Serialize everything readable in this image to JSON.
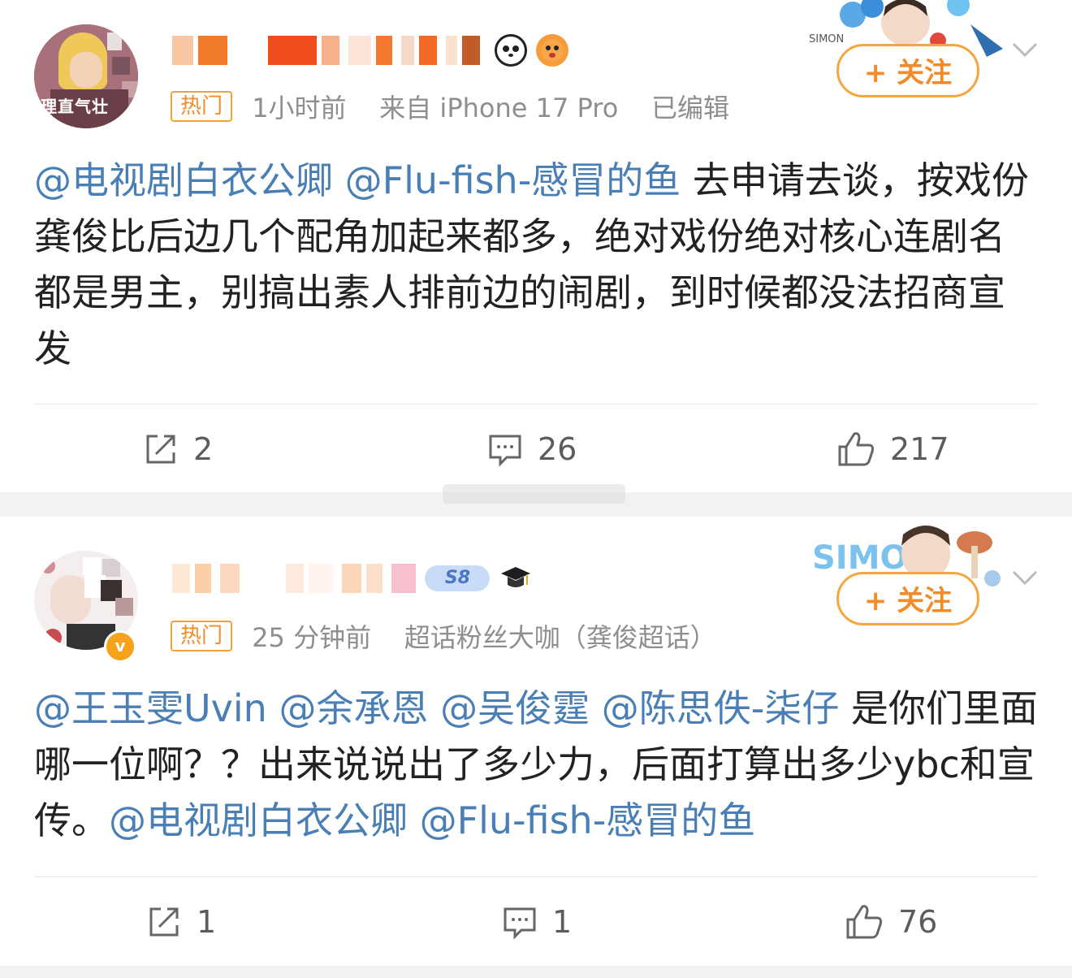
{
  "posts": [
    {
      "avatar_caption": "理直气壮",
      "hot_label": "热门",
      "time": "1小时前",
      "source": "来自 iPhone 17 Pro",
      "edited": "已编辑",
      "follow_label": "+ 关注",
      "deco_text": "SIMON",
      "content": [
        {
          "text": "@电视剧白衣公卿",
          "mention": true
        },
        {
          "text": " ",
          "mention": false
        },
        {
          "text": "@Flu-fish-感冒的鱼",
          "mention": true
        },
        {
          "text": " 去申请去谈，按戏份龚俊比后边几个配角加起来都多，绝对戏份绝对核心连剧名都是男主，别搞出素人排前边的闹剧，到时候都没法招商宣发",
          "mention": false
        }
      ],
      "repost_count": "2",
      "comment_count": "26",
      "like_count": "217"
    },
    {
      "hot_label": "热门",
      "time": "25 分钟前",
      "source": "超话粉丝大咖（龚俊超话）",
      "level_badge": "S8",
      "follow_label": "+ 关注",
      "deco_text": "SIMON",
      "verified_label": "v",
      "content": [
        {
          "text": "@王玉雯Uvin",
          "mention": true
        },
        {
          "text": " ",
          "mention": false
        },
        {
          "text": "@余承恩",
          "mention": true
        },
        {
          "text": " ",
          "mention": false
        },
        {
          "text": "@吴俊霆",
          "mention": true
        },
        {
          "text": " ",
          "mention": false
        },
        {
          "text": "@陈思佚-柒仔",
          "mention": true
        },
        {
          "text": " 是你们里面哪一位啊？？出来说说出了多少力，后面打算出多少ybc和宣传。",
          "mention": false
        },
        {
          "text": "@电视剧白衣公卿",
          "mention": true
        },
        {
          "text": " ",
          "mention": false
        },
        {
          "text": "@Flu-fish-感冒的鱼",
          "mention": true
        }
      ],
      "repost_count": "1",
      "comment_count": "1",
      "like_count": "76"
    }
  ],
  "colors": {
    "mention": "#4a7fb5",
    "follow_orange": "#f28c28",
    "meta_gray": "#8e8e8e",
    "separator": "#f2f2f2"
  },
  "icons": [
    "repost-icon",
    "comment-icon",
    "like-icon",
    "chevron-down-icon",
    "panda-icon",
    "pufferfish-icon",
    "graduation-cap-icon"
  ]
}
